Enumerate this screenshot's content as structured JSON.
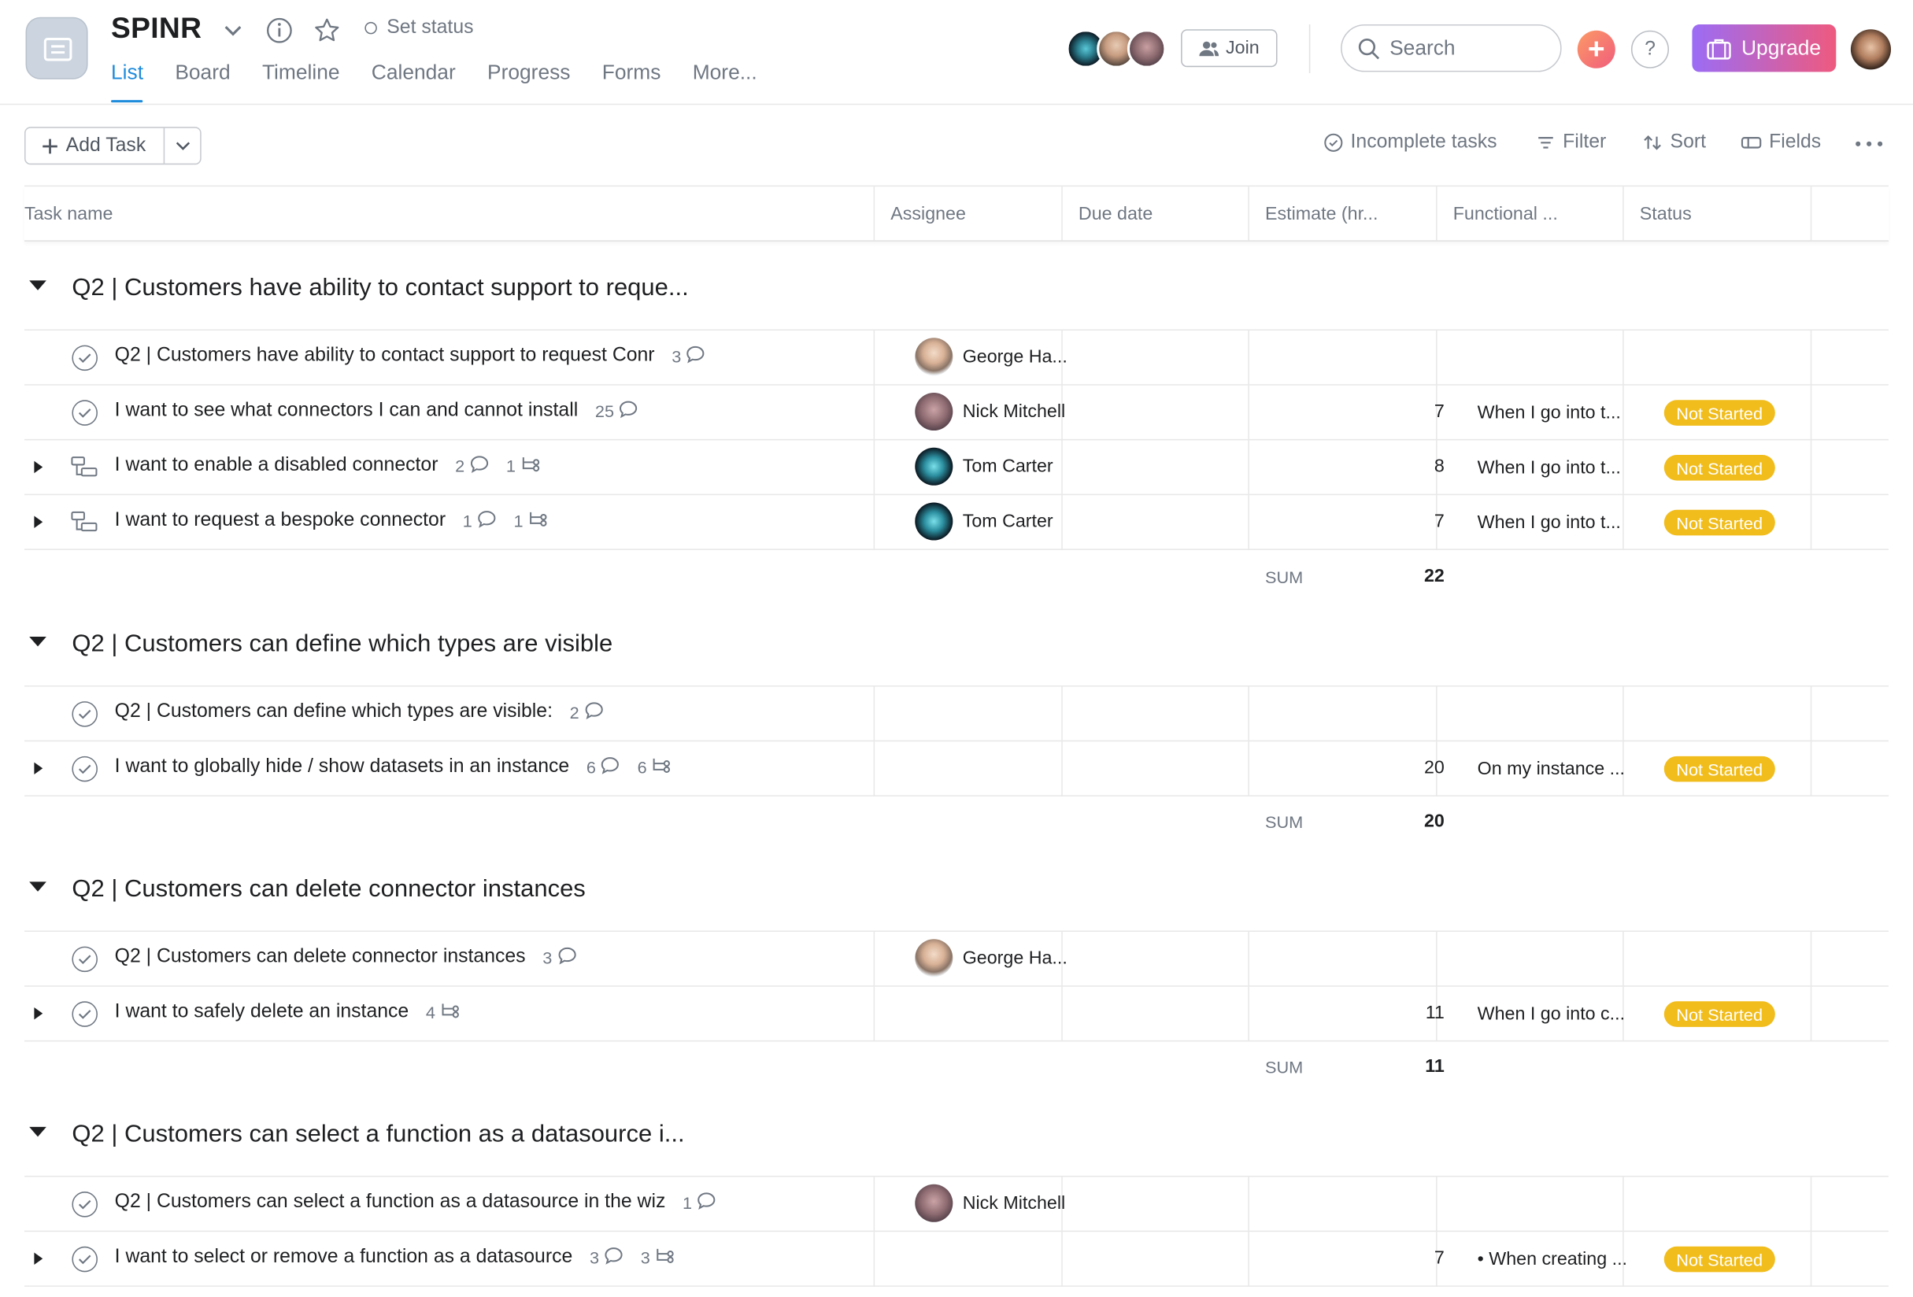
{
  "project": {
    "title": "SPINR",
    "set_status": "Set status"
  },
  "tabs": [
    "List",
    "Board",
    "Timeline",
    "Calendar",
    "Progress",
    "Forms",
    "More..."
  ],
  "header": {
    "join": "Join",
    "search_placeholder": "Search",
    "help": "?",
    "upgrade": "Upgrade"
  },
  "toolbar": {
    "add_task": "Add Task",
    "incomplete": "Incomplete tasks",
    "filter": "Filter",
    "sort": "Sort",
    "fields": "Fields"
  },
  "columns": [
    "Task name",
    "Assignee",
    "Due date",
    "Estimate (hr...",
    "Functional ...",
    "Status"
  ],
  "sections": [
    {
      "title": "Q2 | Customers have ability to contact support to reque...",
      "rows": [
        {
          "name": "Q2 | Customers have ability to contact support to request Conr",
          "comments": "3",
          "subtasks": "",
          "assignee": "George Ha...",
          "estimate": "",
          "functional": "",
          "status": ""
        },
        {
          "name": "I want to see what connectors I can and cannot install",
          "comments": "25",
          "subtasks": "",
          "assignee": "Nick Mitchell",
          "estimate": "7",
          "functional": "When I go into t...",
          "status": "Not Started"
        },
        {
          "name": "I want to enable a disabled connector",
          "comments": "2",
          "subtasks": "1",
          "assignee": "Tom Carter",
          "estimate": "8",
          "functional": "When I go into t...",
          "status": "Not Started"
        },
        {
          "name": "I want to request a bespoke connector",
          "comments": "1",
          "subtasks": "1",
          "assignee": "Tom Carter",
          "estimate": "7",
          "functional": "When I go into t...",
          "status": "Not Started"
        }
      ],
      "sum_label": "SUM",
      "sum": "22"
    },
    {
      "title": "Q2 | Customers can define which types are visible",
      "rows": [
        {
          "name": "Q2 | Customers can define which types are visible:",
          "comments": "2",
          "subtasks": "",
          "assignee": "",
          "estimate": "",
          "functional": "",
          "status": ""
        },
        {
          "name": "I want to globally hide / show datasets in an instance",
          "comments": "6",
          "subtasks": "6",
          "assignee": "",
          "estimate": "20",
          "functional": "On my instance ...",
          "status": "Not Started"
        }
      ],
      "sum_label": "SUM",
      "sum": "20"
    },
    {
      "title": "Q2 | Customers can delete connector instances",
      "rows": [
        {
          "name": "Q2 | Customers can delete connector instances",
          "comments": "3",
          "subtasks": "",
          "assignee": "George Ha...",
          "estimate": "",
          "functional": "",
          "status": ""
        },
        {
          "name": "I want to safely delete an instance",
          "comments": "",
          "subtasks": "4",
          "assignee": "",
          "estimate": "11",
          "functional": "When I go into c...",
          "status": "Not Started"
        }
      ],
      "sum_label": "SUM",
      "sum": "11"
    },
    {
      "title": "Q2 | Customers can select a function as a datasource i...",
      "rows": [
        {
          "name": "Q2 | Customers can select a function as a datasource in the wiz",
          "comments": "1",
          "subtasks": "",
          "assignee": "Nick Mitchell",
          "estimate": "",
          "functional": "",
          "status": ""
        },
        {
          "name": "I want to select or remove a function as a datasource",
          "comments": "3",
          "subtasks": "3",
          "assignee": "",
          "estimate": "7",
          "functional": "• When creating ...",
          "status": "Not Started"
        }
      ]
    }
  ],
  "colors": {
    "accent": "#1f8bdb",
    "status_badge": "#f1bd1d",
    "upgrade_from": "#9b6cf5",
    "upgrade_to": "#ee5a7f",
    "add": "#f05d7c"
  }
}
